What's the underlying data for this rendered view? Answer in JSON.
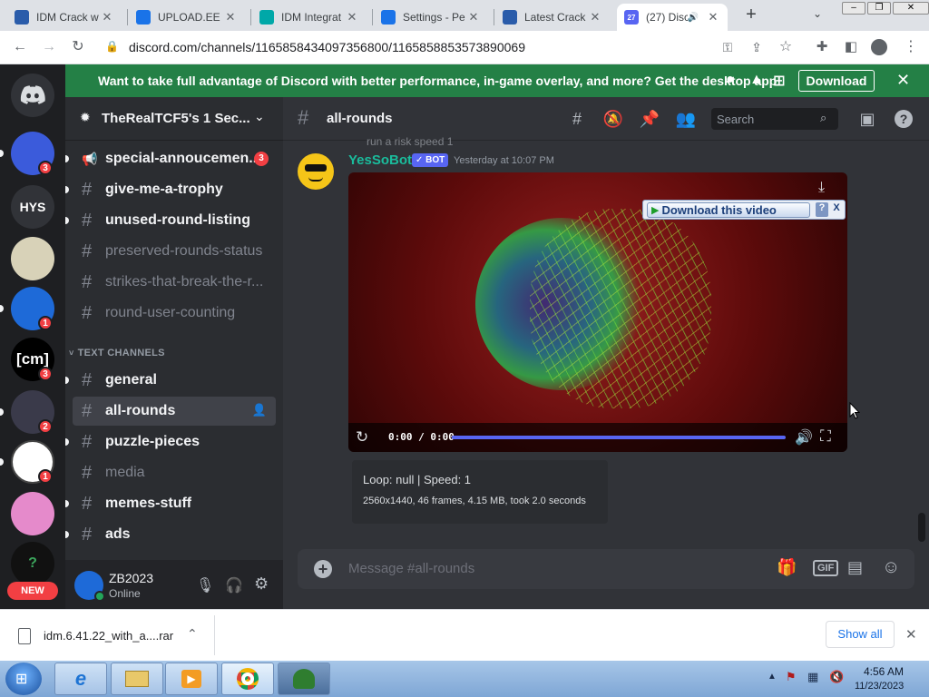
{
  "browser": {
    "tabs": [
      {
        "title": "IDM Crack w",
        "icon": "idm-icon",
        "color": "#2a5caa"
      },
      {
        "title": "UPLOAD.EE -",
        "icon": "upload-icon",
        "color": "#1a73e8"
      },
      {
        "title": "IDM Integrat",
        "icon": "puzzle-icon",
        "color": "#00a8a8"
      },
      {
        "title": "Settings - Pe",
        "icon": "gear-icon",
        "color": "#1a73e8"
      },
      {
        "title": "Latest Crack",
        "icon": "idm-icon",
        "color": "#2a5caa"
      },
      {
        "title": "(27) Disc",
        "icon": "discord-icon",
        "color": "#5865f2",
        "badge": "27"
      }
    ],
    "url": "discord.com/channels/1165858434097356800/1165858853573890069"
  },
  "banner": {
    "text": "Want to take full advantage of Discord with better performance, in-game overlay, and more? Get the desktop app!",
    "download_label": "Download"
  },
  "servers": [
    {
      "label": "",
      "badge": "3",
      "color": "#3b5bdb"
    },
    {
      "label": "HYS",
      "badge": "",
      "color": "#313338"
    },
    {
      "label": "",
      "badge": "",
      "color": "#d8d2b8"
    },
    {
      "label": "",
      "badge": "1",
      "color": "#1e6ad8"
    },
    {
      "label": "[cm]",
      "badge": "3",
      "color": "#000000"
    },
    {
      "label": "",
      "badge": "2",
      "color": "#3a3a4a"
    },
    {
      "label": "",
      "badge": "1",
      "color": "#ffffff"
    },
    {
      "label": "",
      "badge": "",
      "color": "#e58acb"
    },
    {
      "label": "?",
      "badge": "",
      "color": "#111111"
    }
  ],
  "new_label": "NEW",
  "server_name": "TheRealTCF5's 1 Sec...",
  "channels_top": [
    {
      "name": "special-annoucemen...",
      "state": "unread",
      "icon": "megaphone",
      "badge": "3"
    },
    {
      "name": "give-me-a-trophy",
      "state": "unread"
    },
    {
      "name": "unused-round-listing",
      "state": "unread"
    },
    {
      "name": "preserved-rounds-status",
      "state": "muted"
    },
    {
      "name": "strikes-that-break-the-r...",
      "state": "muted"
    },
    {
      "name": "round-user-counting",
      "state": "muted"
    }
  ],
  "category": "TEXT CHANNELS",
  "channels_text": [
    {
      "name": "general",
      "state": "unread"
    },
    {
      "name": "all-rounds",
      "state": "selected"
    },
    {
      "name": "puzzle-pieces",
      "state": "unread"
    },
    {
      "name": "media",
      "state": "muted"
    },
    {
      "name": "memes-stuff",
      "state": "unread"
    },
    {
      "name": "ads",
      "state": "unread"
    }
  ],
  "user": {
    "name": "ZB2023",
    "status": "Online"
  },
  "channel_header": {
    "name": "all-rounds",
    "search_placeholder": "Search"
  },
  "message": {
    "reply_text": "run a risk speed 1",
    "author": "YesSoBot",
    "bot_tag": "BOT",
    "timestamp": "Yesterday at 10:07 PM",
    "video_time": "0:00 / 0:00",
    "idm_label": "Download this video",
    "idm_help": "?",
    "idm_close": "X",
    "embed_line1": "Loop: null | Speed: 1",
    "embed_line2": "2560x1440, 46 frames, 4.15 MB, took 2.0 seconds"
  },
  "composer_placeholder": "Message #all-rounds",
  "gif_label": "GIF",
  "downloads": {
    "file": "idm.6.41.22_with_a....rar",
    "show_all": "Show all"
  },
  "clock": {
    "time": "4:56 AM",
    "date": "11/23/2023"
  }
}
